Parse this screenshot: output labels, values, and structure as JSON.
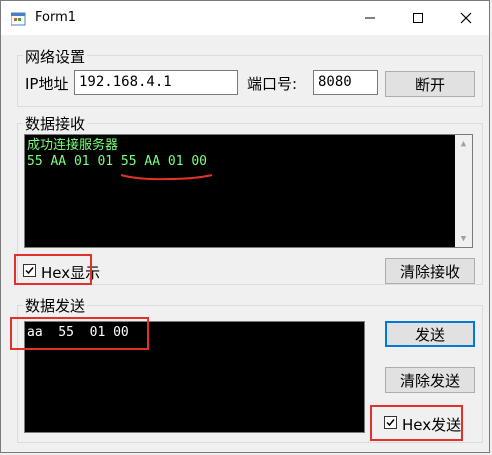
{
  "window": {
    "title": "Form1"
  },
  "network": {
    "group_title": "网络设置",
    "ip_label": "IP地址",
    "ip_value": "192.168.4.1",
    "port_label": "端口号:",
    "port_value": "8080",
    "disconnect_label": "断开"
  },
  "receive": {
    "group_title": "数据接收",
    "lines": [
      "成功连接服务器",
      "55 AA 01 01 55 AA 01 00"
    ],
    "hex_label": "Hex显示",
    "hex_checked": true,
    "clear_label": "清除接收"
  },
  "send": {
    "group_title": "数据发送",
    "text": "aa  55  01 00",
    "send_label": "发送",
    "clear_label": "清除发送",
    "hex_label": "Hex发送",
    "hex_checked": true
  },
  "colors": {
    "annotation": "#e0312a",
    "console_text": "#7cff7c",
    "accent": "#0078d7"
  }
}
